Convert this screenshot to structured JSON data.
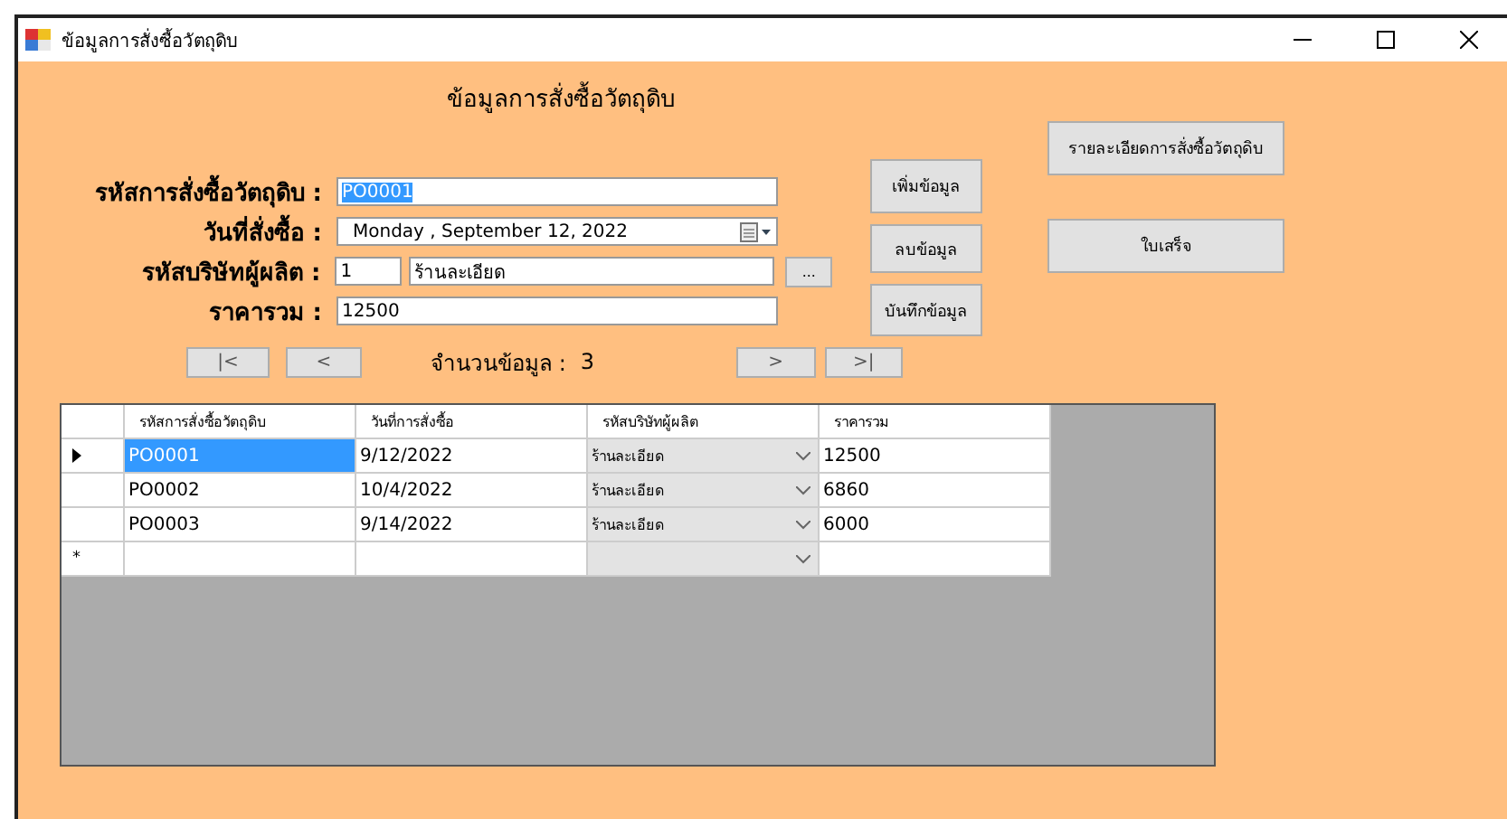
{
  "window": {
    "title": "ข้อมูลการสั่งซื้อวัตถุดิบ"
  },
  "heading": "ข้อมูลการสั่งซื้อวัตถุดิบ",
  "fields": [
    {
      "kind": "text",
      "label": "รหัสการสั่งซื้อวัตถุดิบ :",
      "value": "PO0001",
      "selected": true
    },
    {
      "kind": "date",
      "label": "วันที่สั่งซื้อ :",
      "value": "Monday   , September 12, 2022"
    },
    {
      "kind": "lookup",
      "label": "รหัสบริษัทผู้ผลิต :",
      "value": "1",
      "name": "ร้านละเอียด",
      "browse": "..."
    },
    {
      "kind": "text",
      "label": "ราคารวม :",
      "value": "12500",
      "selected": false
    }
  ],
  "actions": [
    "เพิ่มข้อมูล",
    "ลบข้อมูล",
    "บันทึกข้อมูล"
  ],
  "side_buttons": [
    "รายละเอียดการสั่งซื้อวัตถุดิบ",
    "ใบเสร็จ"
  ],
  "nav": {
    "first": "|<",
    "prev": "<",
    "count_label": "จำนวนข้อมูล :",
    "count": "3",
    "next": ">",
    "last": ">|"
  },
  "grid": {
    "columns": [
      "รหัสการสั่งซื้อวัตถุดิบ",
      "วันที่การสั่งซื้อ",
      "รหัสบริษัทผู้ผลิต",
      "ราคารวม"
    ],
    "rows": [
      {
        "current": true,
        "cells": [
          "PO0001",
          "9/12/2022",
          "ร้านละเอียด",
          "12500"
        ]
      },
      {
        "current": false,
        "cells": [
          "PO0002",
          "10/4/2022",
          "ร้านละเอียด",
          "6860"
        ]
      },
      {
        "current": false,
        "cells": [
          "PO0003",
          "9/14/2022",
          "ร้านละเอียด",
          "6000"
        ]
      }
    ],
    "new_row": {
      "marker": "*"
    }
  }
}
